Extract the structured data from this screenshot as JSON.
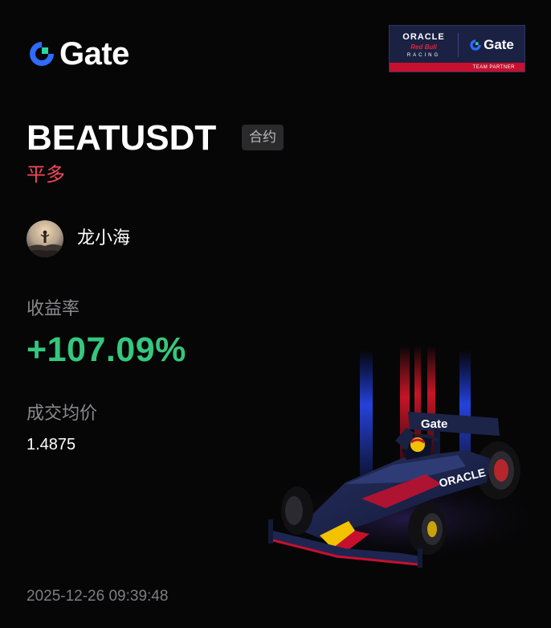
{
  "brand": {
    "name": "Gate",
    "accent": "#2f6bff",
    "accent_green": "#2ad4a3"
  },
  "partner_badge": {
    "team_line1": "ORACLE",
    "team_line2": "Red Bull",
    "team_line3": "RACING",
    "partner_brand": "Gate",
    "footer": "TEAM PARTNER",
    "bg_color": "#1a2142",
    "stripe_color": "#c8102e"
  },
  "position": {
    "symbol": "BEATUSDT",
    "contract_tag": "合约",
    "side": "平多",
    "side_color": "#f04a5c"
  },
  "user": {
    "name": "龙小海",
    "avatar_icon": "user-avatar-photo"
  },
  "metrics": {
    "yield_label": "收益率",
    "yield_value": "+107.09%",
    "yield_color": "#35c77e",
    "avg_price_label": "成交均价",
    "avg_price_value": "1.4875"
  },
  "timestamp": "2025-12-26 09:39:48",
  "decor": {
    "car_icon": "f1-race-car-illustration"
  }
}
